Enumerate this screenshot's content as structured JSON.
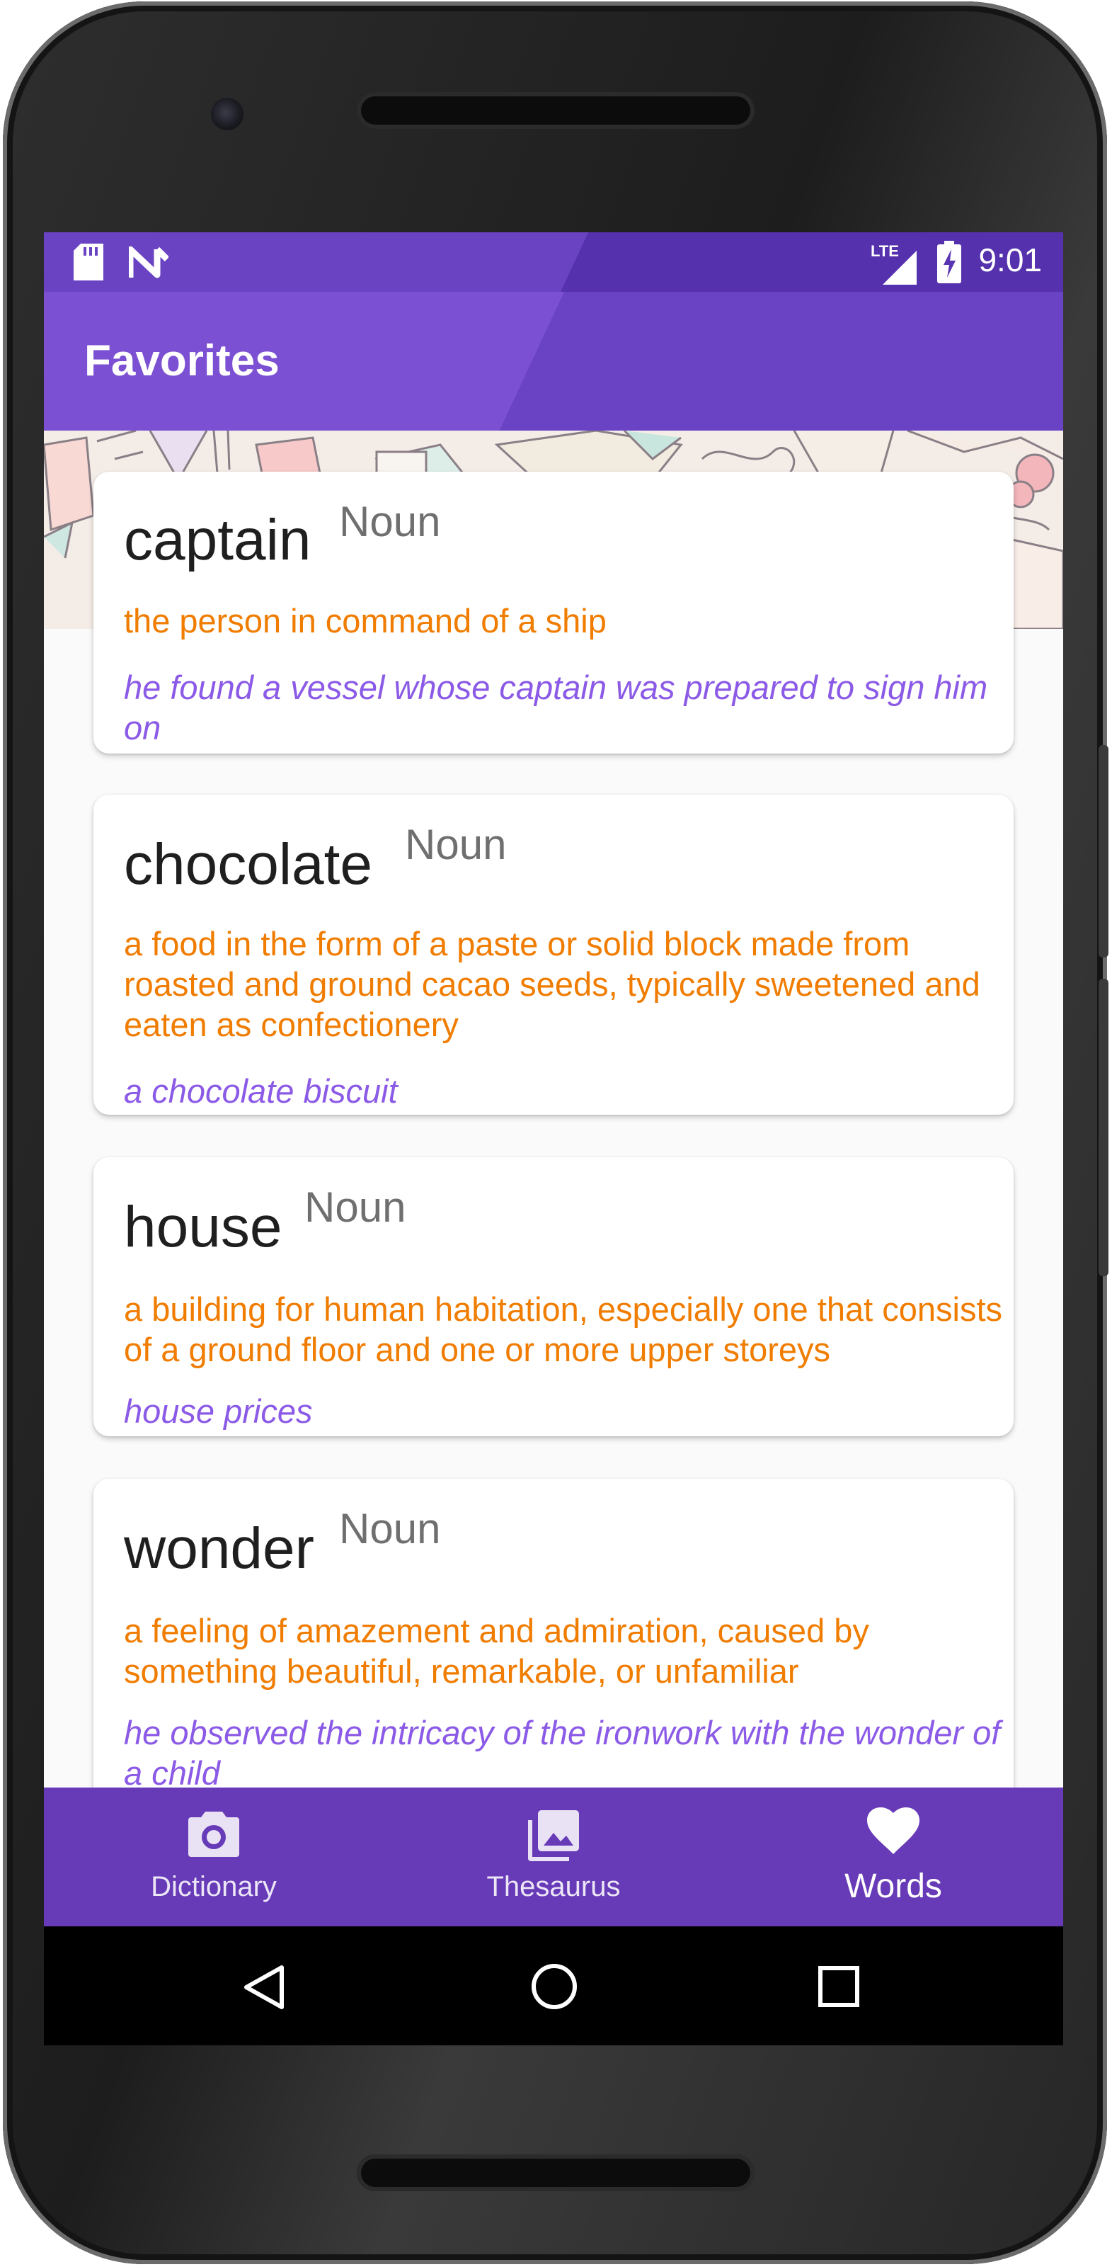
{
  "status_bar": {
    "time": "9:01",
    "left_icons": [
      "sd-card-icon",
      "n-logo-icon"
    ],
    "right_icons": [
      "lte-signal-icon",
      "battery-charging-icon"
    ],
    "network_label": "LTE"
  },
  "app_bar": {
    "title": "Favorites"
  },
  "favorites": [
    {
      "word": "captain",
      "part_of_speech": "Noun",
      "definition": "the person in command of a ship",
      "example": "he found a vessel whose captain was prepared to sign him on"
    },
    {
      "word": "chocolate",
      "part_of_speech": "Noun",
      "definition": "a food in the form of a paste or solid block made from roasted and ground cacao seeds, typically sweetened and eaten as confectionery",
      "example": "a chocolate biscuit"
    },
    {
      "word": "house",
      "part_of_speech": "Noun",
      "definition": "a building for human habitation, especially one that consists of a ground floor and one or more upper storeys",
      "example": "house prices"
    },
    {
      "word": "wonder",
      "part_of_speech": "Noun",
      "definition": "a feeling of amazement and admiration, caused by something beautiful, remarkable, or unfamiliar",
      "example": "he observed the intricacy of the ironwork with the wonder of a child"
    }
  ],
  "bottom_nav": {
    "items": [
      {
        "label": "Dictionary",
        "icon": "camera-icon",
        "active": false
      },
      {
        "label": "Thesaurus",
        "icon": "photo-library-icon",
        "active": false
      },
      {
        "label": "Words",
        "icon": "heart-icon",
        "active": true
      }
    ]
  },
  "system_nav": {
    "buttons": [
      "back-icon",
      "home-icon",
      "recents-icon"
    ]
  },
  "colors": {
    "primary": "#673ab7",
    "definition": "#f07c00",
    "example": "#8b5ae6",
    "word": "#1f1f1f",
    "part_of_speech": "#6f6f6f"
  }
}
